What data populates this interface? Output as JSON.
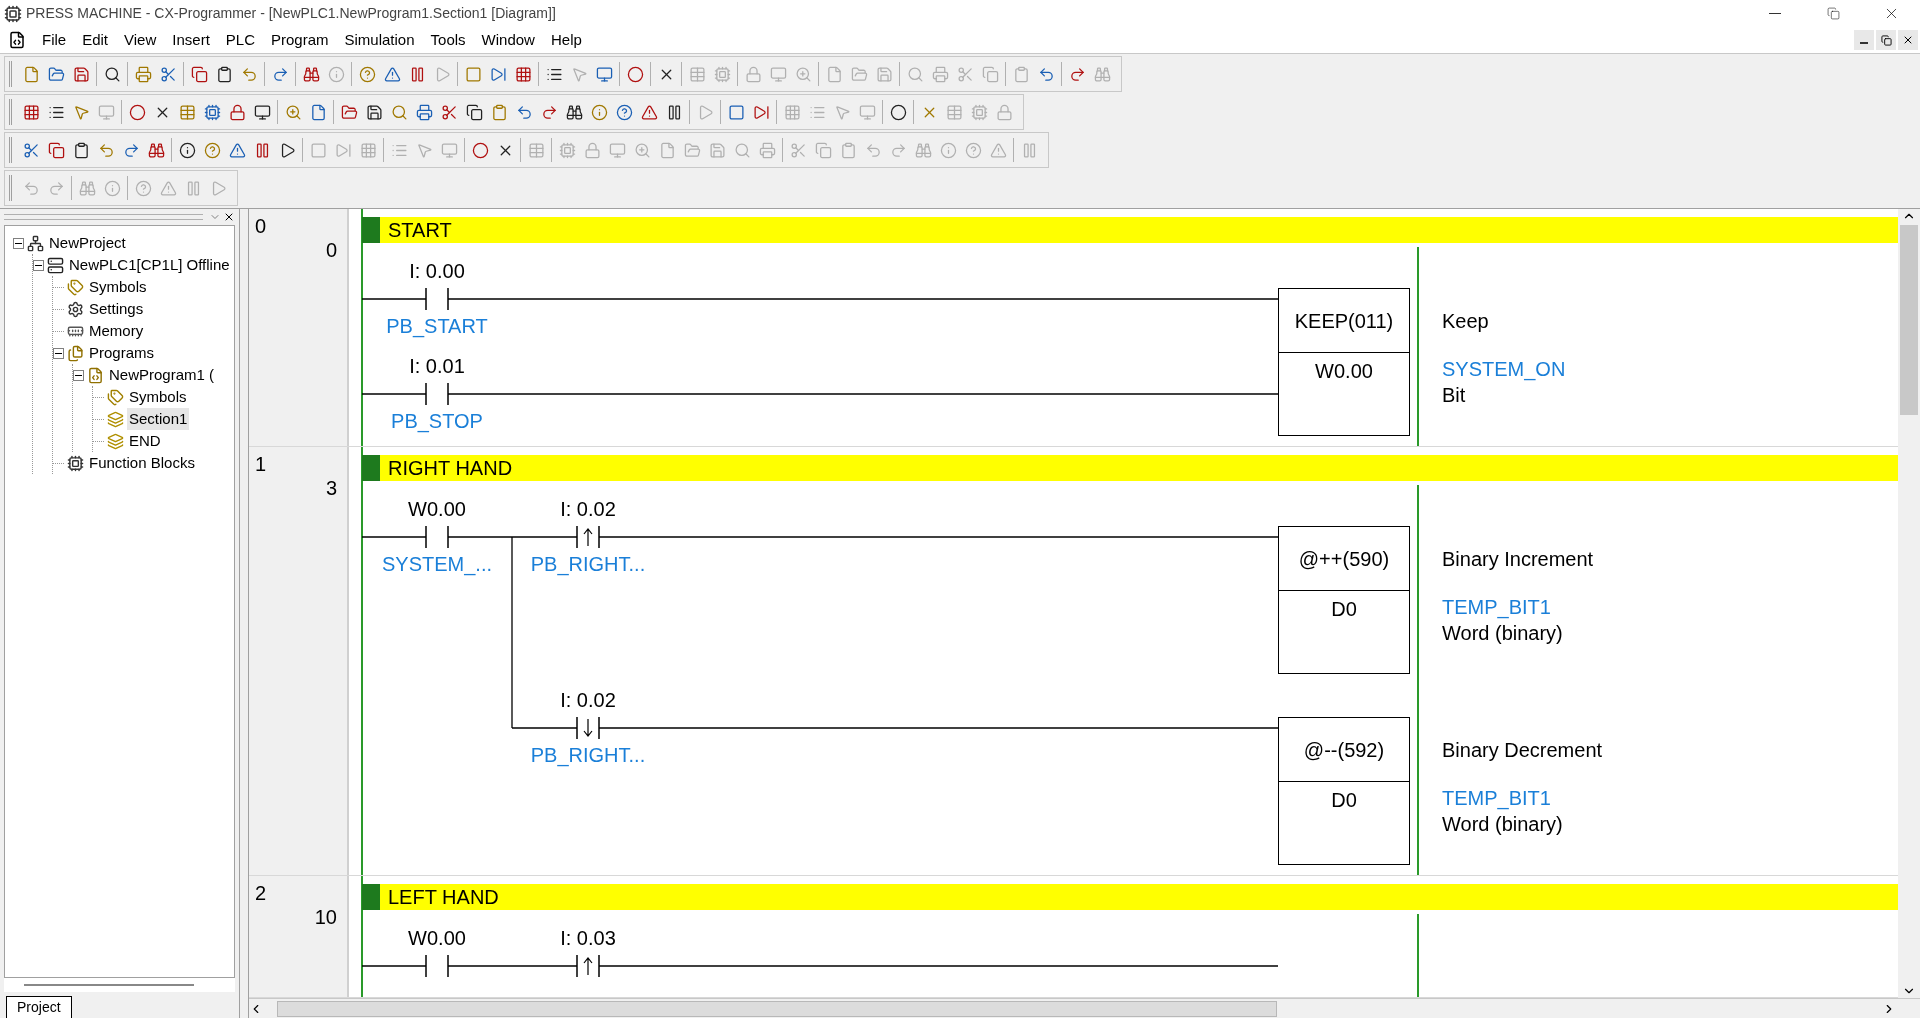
{
  "window": {
    "title": "PRESS MACHINE - CX-Programmer - [NewPLC1.NewProgram1.Section1 [Diagram]]"
  },
  "menu": [
    "File",
    "Edit",
    "View",
    "Insert",
    "PLC",
    "Program",
    "Simulation",
    "Tools",
    "Window",
    "Help"
  ],
  "toolbars": [
    {
      "groups": [
        [
          {
            "disabled": false
          },
          {
            "disabled": false
          },
          {
            "disabled": false
          }
        ],
        [
          {
            "disabled": false
          }
        ],
        [
          {
            "disabled": false
          },
          {
            "disabled": false
          }
        ],
        [
          {
            "disabled": false
          },
          {
            "disabled": false
          },
          {
            "disabled": false
          }
        ],
        [
          {
            "disabled": false
          }
        ],
        [
          {
            "disabled": false
          },
          {
            "disabled": true
          }
        ],
        [
          {
            "disabled": false
          },
          {
            "disabled": false
          },
          {
            "disabled": false
          },
          {
            "disabled": true
          }
        ],
        [
          {
            "disabled": false
          },
          {
            "disabled": false
          },
          {
            "disabled": false
          }
        ],
        [
          {
            "disabled": false
          },
          {
            "disabled": true
          },
          {
            "disabled": false
          }
        ],
        [
          {
            "disabled": false
          }
        ],
        [
          {
            "disabled": false
          }
        ],
        [
          {
            "disabled": true
          },
          {
            "disabled": true
          }
        ],
        [
          {
            "disabled": true
          },
          {
            "disabled": true
          },
          {
            "disabled": true
          }
        ],
        [
          {
            "disabled": true
          },
          {
            "disabled": true
          },
          {
            "disabled": true
          }
        ],
        [
          {
            "disabled": true
          },
          {
            "disabled": true
          },
          {
            "disabled": true
          },
          {
            "disabled": true
          }
        ],
        [
          {
            "disabled": true
          },
          {
            "disabled": false
          }
        ],
        [
          {
            "disabled": false
          },
          {
            "disabled": true
          }
        ]
      ]
    },
    {
      "groups": [
        [
          {
            "disabled": false
          },
          {
            "disabled": false
          },
          {
            "disabled": false
          },
          {
            "disabled": true
          }
        ],
        [
          {
            "disabled": false
          },
          {
            "disabled": false
          },
          {
            "disabled": false
          },
          {
            "disabled": false
          },
          {
            "disabled": false
          },
          {
            "disabled": false
          }
        ],
        [
          {
            "disabled": false
          },
          {
            "disabled": false
          }
        ],
        [
          {
            "disabled": false
          },
          {
            "disabled": false
          },
          {
            "disabled": false
          },
          {
            "disabled": false
          },
          {
            "disabled": false
          },
          {
            "disabled": false
          },
          {
            "disabled": false
          },
          {
            "disabled": false
          },
          {
            "disabled": false
          },
          {
            "disabled": false
          },
          {
            "disabled": false
          },
          {
            "disabled": false
          },
          {
            "disabled": false
          },
          {
            "disabled": false
          }
        ],
        [
          {
            "disabled": true
          }
        ],
        [
          {
            "disabled": false
          },
          {
            "disabled": false
          }
        ],
        [
          {
            "disabled": true
          },
          {
            "disabled": true
          },
          {
            "disabled": true
          },
          {
            "disabled": true
          }
        ],
        [
          {
            "disabled": false
          }
        ],
        [
          {
            "disabled": false
          },
          {
            "disabled": true
          },
          {
            "disabled": true
          },
          {
            "disabled": true
          }
        ]
      ]
    },
    {
      "groups": [
        [
          {
            "disabled": false
          },
          {
            "disabled": false
          },
          {
            "disabled": false
          },
          {
            "disabled": false
          },
          {
            "disabled": false
          },
          {
            "disabled": false
          }
        ],
        [
          {
            "disabled": false
          },
          {
            "disabled": false
          },
          {
            "disabled": false
          },
          {
            "disabled": false
          },
          {
            "disabled": false
          }
        ],
        [
          {
            "disabled": true
          },
          {
            "disabled": true
          },
          {
            "disabled": true
          }
        ],
        [
          {
            "disabled": true
          },
          {
            "disabled": true
          },
          {
            "disabled": true
          }
        ],
        [
          {
            "disabled": false
          },
          {
            "disabled": false
          }
        ],
        [
          {
            "disabled": true
          }
        ],
        [
          {
            "disabled": true
          },
          {
            "disabled": true
          },
          {
            "disabled": true
          },
          {
            "disabled": true
          },
          {
            "disabled": true
          },
          {
            "disabled": true
          },
          {
            "disabled": true
          },
          {
            "disabled": true
          },
          {
            "disabled": true
          }
        ],
        [
          {
            "disabled": true
          },
          {
            "disabled": true
          },
          {
            "disabled": true
          },
          {
            "disabled": true
          },
          {
            "disabled": true
          },
          {
            "disabled": true
          },
          {
            "disabled": true
          },
          {
            "disabled": true
          },
          {
            "disabled": true
          }
        ],
        [
          {
            "disabled": true
          }
        ]
      ]
    },
    {
      "groups": [
        [
          {
            "disabled": true
          },
          {
            "disabled": true
          }
        ],
        [
          {
            "disabled": true
          },
          {
            "disabled": true
          }
        ],
        [
          {
            "disabled": true
          },
          {
            "disabled": true
          },
          {
            "disabled": true
          },
          {
            "disabled": true
          }
        ]
      ]
    }
  ],
  "project_tree": {
    "items": [
      {
        "label": "NewProject",
        "kind": "project",
        "expanded": true,
        "selected": false,
        "children": [
          {
            "label": "NewPLC1[CP1L] Offline",
            "kind": "plc",
            "expanded": true,
            "selected": false,
            "children": [
              {
                "label": "Symbols",
                "kind": "symbols",
                "selected": false
              },
              {
                "label": "Settings",
                "kind": "settings",
                "selected": false
              },
              {
                "label": "Memory",
                "kind": "memory",
                "selected": false
              },
              {
                "label": "Programs",
                "kind": "programs",
                "expanded": true,
                "selected": false,
                "children": [
                  {
                    "label": "NewProgram1 (",
                    "kind": "program",
                    "expanded": true,
                    "selected": false,
                    "children": [
                      {
                        "label": "Symbols",
                        "kind": "symbols",
                        "selected": false
                      },
                      {
                        "label": "Section1",
                        "kind": "section",
                        "selected": true
                      },
                      {
                        "label": "END",
                        "kind": "section",
                        "selected": false
                      }
                    ]
                  }
                ]
              },
              {
                "label": "Function Blocks",
                "kind": "function_blocks",
                "selected": false
              }
            ]
          }
        ]
      }
    ],
    "tab": "Project"
  },
  "rungs": [
    {
      "number": "0",
      "step": "0",
      "comment": "START",
      "lines": [
        {
          "kind": "rail",
          "contacts": [
            {
              "kind": "no",
              "address": "I: 0.00",
              "symbol": "PB_START"
            }
          ],
          "instruction": {
            "mnemonic": "KEEP(011)",
            "operand": "W0.00",
            "description": "Keep",
            "symbol": "SYSTEM_ON",
            "type": "Bit"
          }
        },
        {
          "kind": "rail",
          "contacts": [
            {
              "kind": "no",
              "address": "I: 0.01",
              "symbol": "PB_STOP"
            }
          ]
        }
      ]
    },
    {
      "number": "1",
      "step": "3",
      "comment": "RIGHT HAND",
      "lines": [
        {
          "kind": "rail",
          "contacts": [
            {
              "kind": "no",
              "address": "W0.00",
              "symbol": "SYSTEM_..."
            },
            {
              "kind": "rising",
              "address": "I: 0.02",
              "symbol": "PB_RIGHT..."
            }
          ],
          "instruction": {
            "mnemonic": "@++(590)",
            "operand": "D0",
            "description": "Binary Increment",
            "symbol": "TEMP_BIT1",
            "type": "Word (binary)"
          }
        },
        {
          "kind": "branch",
          "contacts": [
            {
              "kind": "falling",
              "address": "I: 0.02",
              "symbol": "PB_RIGHT..."
            }
          ],
          "instruction": {
            "mnemonic": "@--(592)",
            "operand": "D0",
            "description": "Binary Decrement",
            "symbol": "TEMP_BIT1",
            "type": "Word (binary)"
          }
        }
      ]
    },
    {
      "number": "2",
      "step": "10",
      "comment": "LEFT HAND",
      "lines": [
        {
          "kind": "rail",
          "contacts": [
            {
              "kind": "no",
              "address": "W0.00"
            },
            {
              "kind": "rising",
              "address": "I: 0.03"
            }
          ]
        }
      ]
    }
  ]
}
